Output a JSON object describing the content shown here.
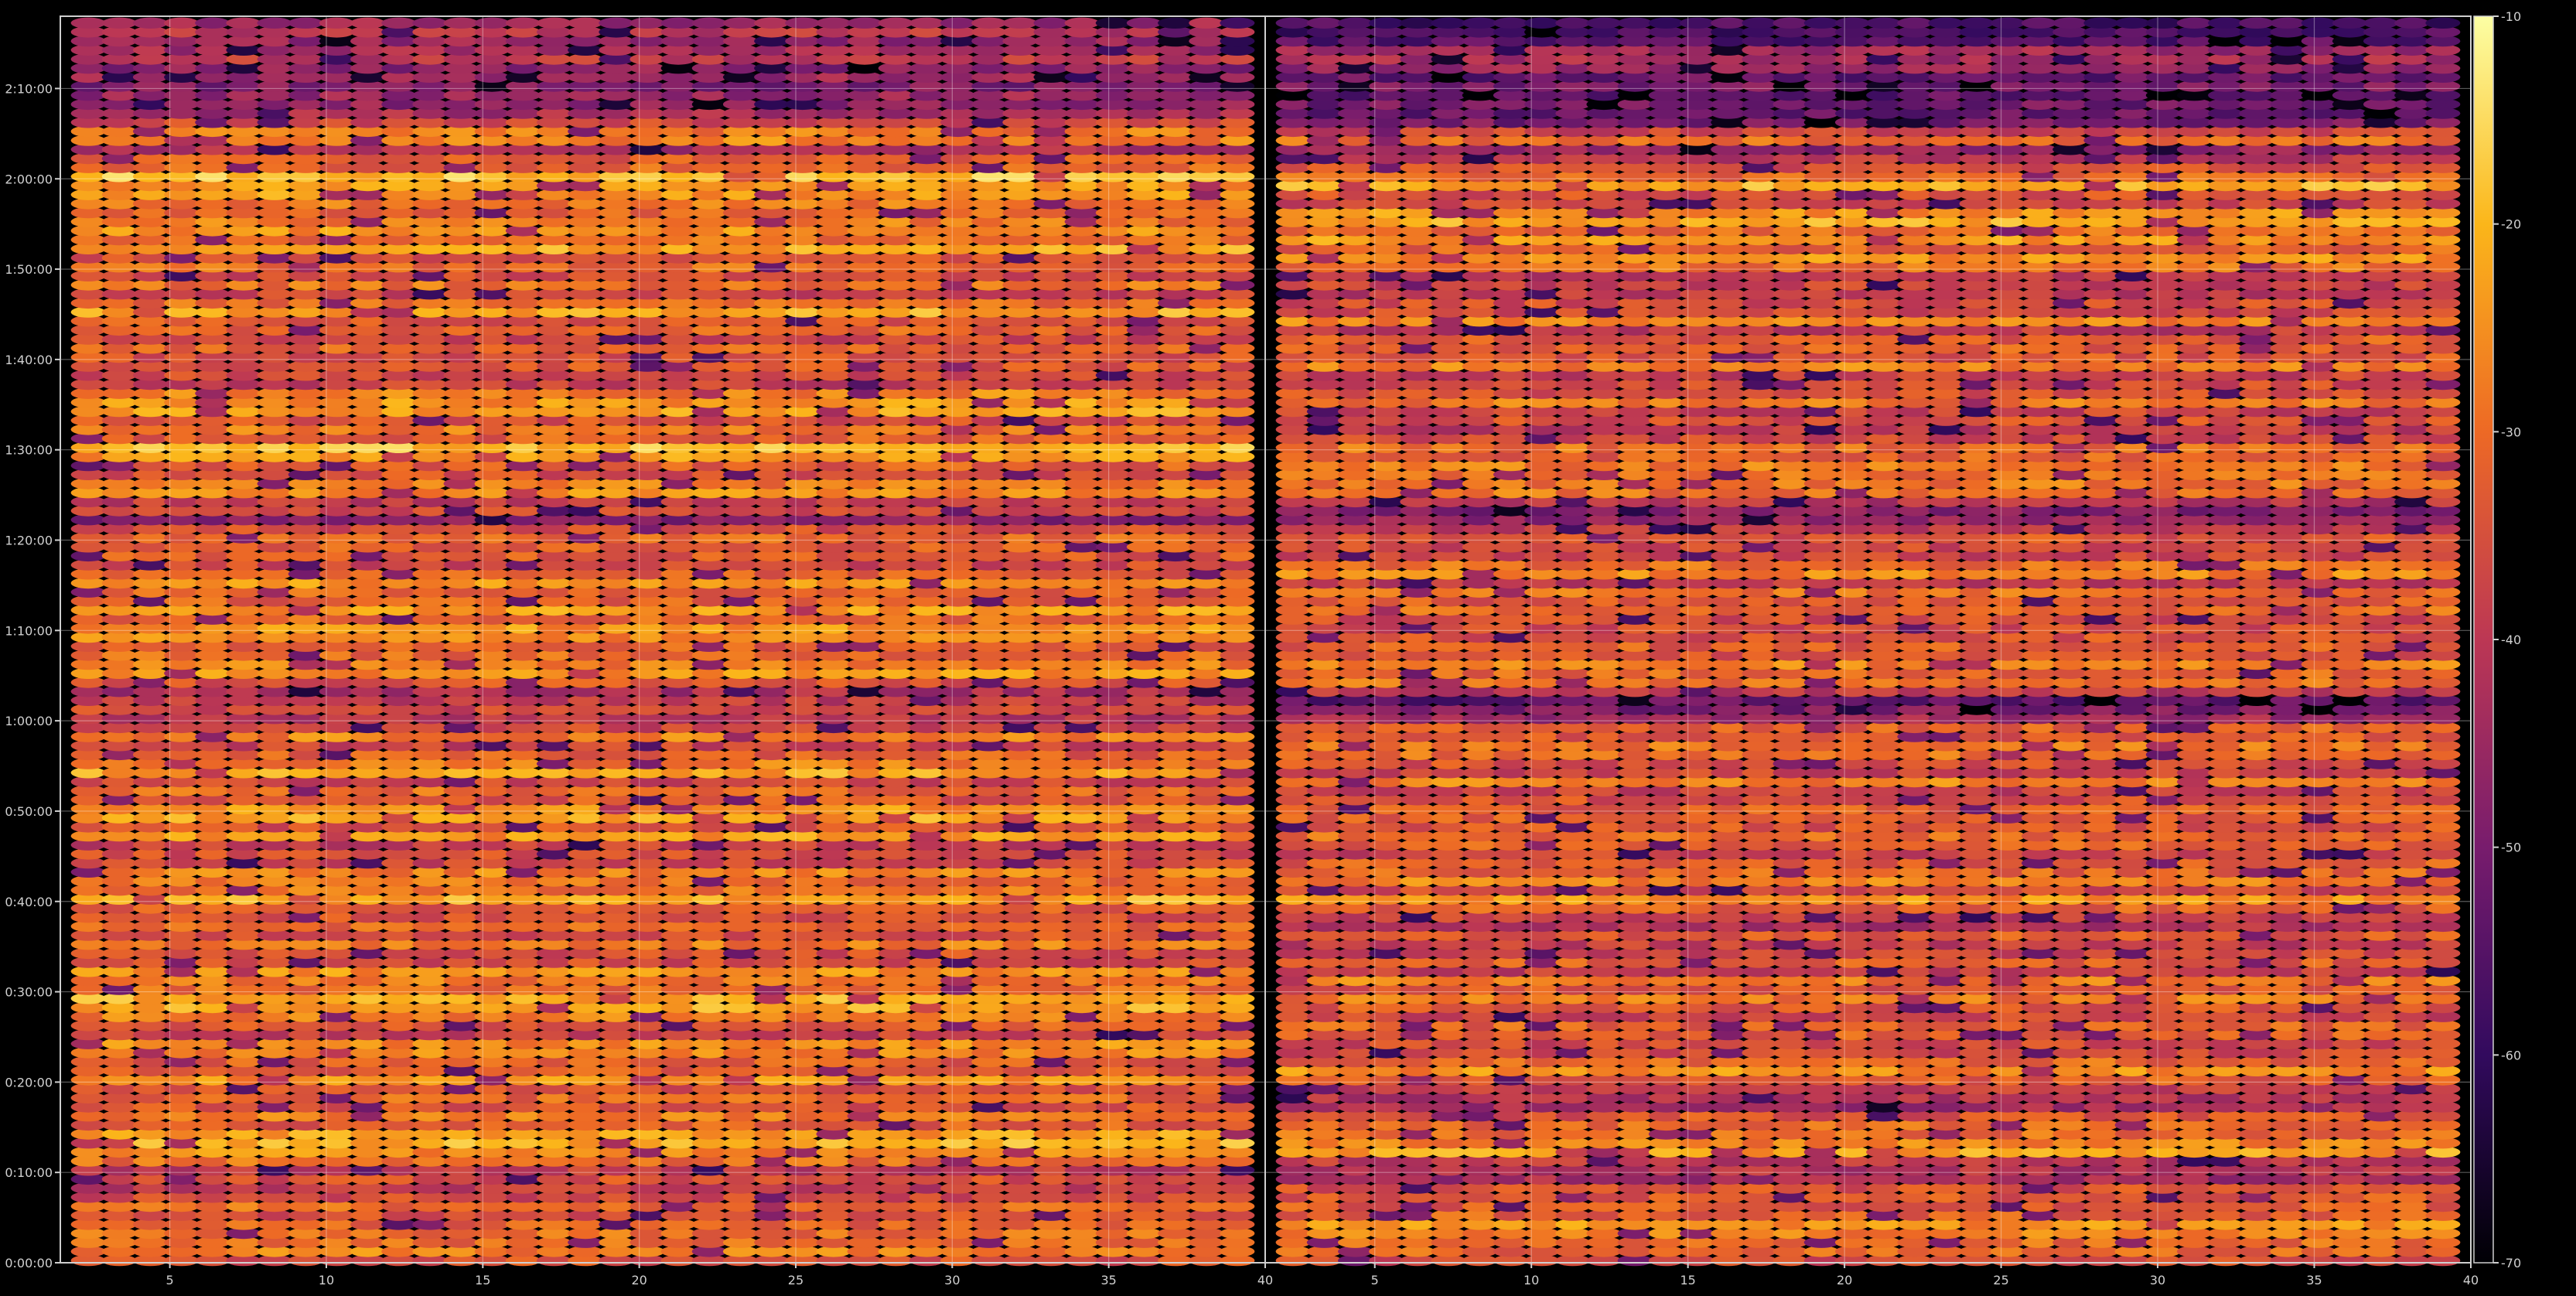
{
  "chart_data": {
    "type": "heatmap",
    "title": "",
    "xlabel": "",
    "ylabel": "",
    "panels": [
      {
        "name": "",
        "xlim": [
          1.5,
          40
        ],
        "xticks": [
          5,
          10,
          15,
          20,
          25,
          30,
          35,
          40
        ],
        "xtick_labels": [
          "5",
          "10",
          "15",
          "20",
          "25",
          "30",
          "35",
          "40"
        ]
      },
      {
        "name": "",
        "xlim": [
          1.5,
          40
        ],
        "xticks": [
          5,
          10,
          15,
          20,
          25,
          30,
          35,
          40
        ],
        "xtick_labels": [
          "5",
          "10",
          "15",
          "20",
          "25",
          "30",
          "35",
          "40"
        ]
      }
    ],
    "x_columns": [
      2,
      3,
      4,
      5,
      6,
      7,
      8,
      9,
      10,
      11,
      12,
      13,
      14,
      15,
      16,
      17,
      18,
      19,
      20,
      21,
      22,
      23,
      24,
      25,
      26,
      27,
      28,
      29,
      30,
      31,
      32,
      33,
      34,
      35,
      36,
      37,
      38,
      39
    ],
    "ylim_seconds": [
      0,
      8280
    ],
    "yticks_seconds": [
      0,
      600,
      1200,
      1800,
      2400,
      3000,
      3600,
      4200,
      4800,
      5400,
      6000,
      6600,
      7200,
      7800
    ],
    "ytick_labels": [
      "0:00:00",
      "0:10:00",
      "0:20:00",
      "0:30:00",
      "0:40:00",
      "0:50:00",
      "1:00:00",
      "1:10:00",
      "1:20:00",
      "1:30:00",
      "1:40:00",
      "1:50:00",
      "2:00:00",
      "2:10:00"
    ],
    "colorbar": {
      "range": [
        -70,
        -10
      ],
      "ticks": [
        -10,
        -20,
        -30,
        -40,
        -50,
        -60,
        -70
      ],
      "tick_labels": [
        "-10",
        "-20",
        "-30",
        "-40",
        "-50",
        "-60",
        "-70"
      ],
      "colormap": "inferno",
      "stops": [
        "#000004",
        "#320a5e",
        "#781c6d",
        "#bc3754",
        "#ed6925",
        "#fbb61a",
        "#fcffa4"
      ]
    },
    "grid": true,
    "row_levels_seconds": [
      [
        300,
        -28
      ],
      [
        450,
        -31
      ],
      [
        600,
        -36
      ],
      [
        750,
        -24
      ],
      [
        900,
        -32
      ],
      [
        1050,
        -35
      ],
      [
        1200,
        -27
      ],
      [
        1350,
        -30
      ],
      [
        1500,
        -34
      ],
      [
        1650,
        -29
      ],
      [
        1800,
        -26
      ],
      [
        1950,
        -31
      ],
      [
        2100,
        -30
      ],
      [
        2250,
        -33
      ],
      [
        2400,
        -27
      ],
      [
        2550,
        -30
      ],
      [
        2700,
        -33
      ],
      [
        2850,
        -30
      ],
      [
        3000,
        -27
      ],
      [
        3150,
        -32
      ],
      [
        3300,
        -26
      ],
      [
        3450,
        -33
      ],
      [
        3600,
        -35
      ],
      [
        3750,
        -45
      ],
      [
        3900,
        -28
      ],
      [
        4050,
        -32
      ],
      [
        4200,
        -27
      ],
      [
        4350,
        -26
      ],
      [
        4500,
        -29
      ],
      [
        4650,
        -31
      ],
      [
        4800,
        -34
      ],
      [
        4950,
        -48
      ],
      [
        5100,
        -30
      ],
      [
        5250,
        -29
      ],
      [
        5400,
        -25
      ],
      [
        5550,
        -33
      ],
      [
        5700,
        -28
      ],
      [
        5850,
        -32
      ],
      [
        6000,
        -30
      ],
      [
        6150,
        -31
      ],
      [
        6300,
        -28
      ],
      [
        6450,
        -36
      ],
      [
        6600,
        -30
      ],
      [
        6750,
        -27
      ],
      [
        6900,
        -25
      ],
      [
        7050,
        -30
      ],
      [
        7200,
        -22
      ],
      [
        7350,
        -41
      ],
      [
        7500,
        -28
      ],
      [
        7650,
        -52
      ],
      [
        7800,
        -49
      ],
      [
        7950,
        -47
      ],
      [
        8100,
        -46
      ],
      [
        8250,
        -48
      ]
    ]
  }
}
